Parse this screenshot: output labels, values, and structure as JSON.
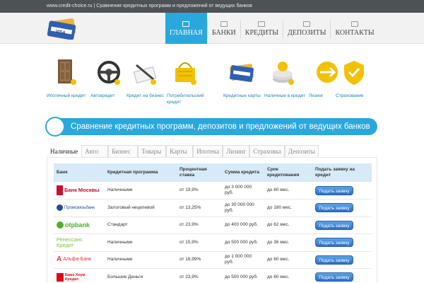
{
  "topbar": {
    "text": "www.credit-choice.ru | Сравнение кредитных программ и предложений от ведущих банков"
  },
  "logo": {
    "brand_text": "VISA"
  },
  "nav": {
    "items": [
      {
        "label": "ГЛАВНАЯ"
      },
      {
        "label": "БАНКИ"
      },
      {
        "label": "КРЕДИТЫ"
      },
      {
        "label": "ДЕПОЗИТЫ"
      },
      {
        "label": "КОНТАКТЫ"
      }
    ]
  },
  "categories": [
    {
      "label": "Ипотечный кредит",
      "icon": "door-icon"
    },
    {
      "label": "Автокредит",
      "icon": "steering-wheel-icon"
    },
    {
      "label": "Кредит на бизнес",
      "icon": "pen-document-icon"
    },
    {
      "label": "Потребительский кредит",
      "icon": "shopping-basket-icon"
    },
    {
      "label": "Кредитные карты",
      "icon": "credit-card-icon"
    },
    {
      "label": "Наличные в кредит",
      "icon": "coins-icon"
    },
    {
      "label": "Лизинг",
      "icon": "leasing-icon"
    },
    {
      "label": "Страхование",
      "icon": "insurance-icon"
    }
  ],
  "banner": {
    "title": "Сравнение кредитных программ, депозитов и предложений от ведущих банков"
  },
  "tabs": [
    {
      "label": "Наличные"
    },
    {
      "label": "Авто"
    },
    {
      "label": "Бизнес"
    },
    {
      "label": "Товары"
    },
    {
      "label": "Карты"
    },
    {
      "label": "Ипотека"
    },
    {
      "label": "Лизинг"
    },
    {
      "label": "Страховка"
    },
    {
      "label": "Депозиты"
    }
  ],
  "table": {
    "headers": [
      "Банк",
      "Кредитная программа",
      "Процентная ставка",
      "Сумма кредита",
      "Срок кредитования",
      "Подать заявку на кредит"
    ],
    "rows": [
      {
        "bank": "Банк Москвы",
        "program": "Наличными",
        "rate": "от 19,9%",
        "amount": "до 3 000 000 руб.",
        "term": "до 60 мес.",
        "button": "Подать заявку"
      },
      {
        "bank": "Промсвязьбанк",
        "program": "Залоговый нецелевой",
        "rate": "от 13,25%",
        "amount": "до 30 000 000 руб.",
        "term": "до 180 мес.",
        "button": "Подать заявку"
      },
      {
        "bank": "otpbank",
        "program": "Стандарт",
        "rate": "от 23,9%",
        "amount": "до 400 000 руб.",
        "term": "до 62 мес.",
        "button": "Подать заявку"
      },
      {
        "bank": "Ренессанс Кредит",
        "program": "Наличными",
        "rate": "от 15,9%",
        "amount": "до 500 000 руб.",
        "term": "до 36 мес.",
        "button": "Подать заявку"
      },
      {
        "bank": "Альфа-Банк",
        "program": "Наличными",
        "rate": "от 16,99%",
        "amount": "до 1 000 000 руб.",
        "term": "до 60 мес.",
        "button": "Подать заявку"
      },
      {
        "bank": "Банк Хоум Кредит",
        "program": "Большие Деньги",
        "rate": "от 23,9%",
        "amount": "до 500 000 руб.",
        "term": "до 60 мес.",
        "button": "Подать заявку"
      }
    ]
  },
  "colors": {
    "accent": "#29a8dd",
    "topbar": "#4d5257",
    "link": "#1e84c0",
    "button": "#2d6fc7"
  }
}
